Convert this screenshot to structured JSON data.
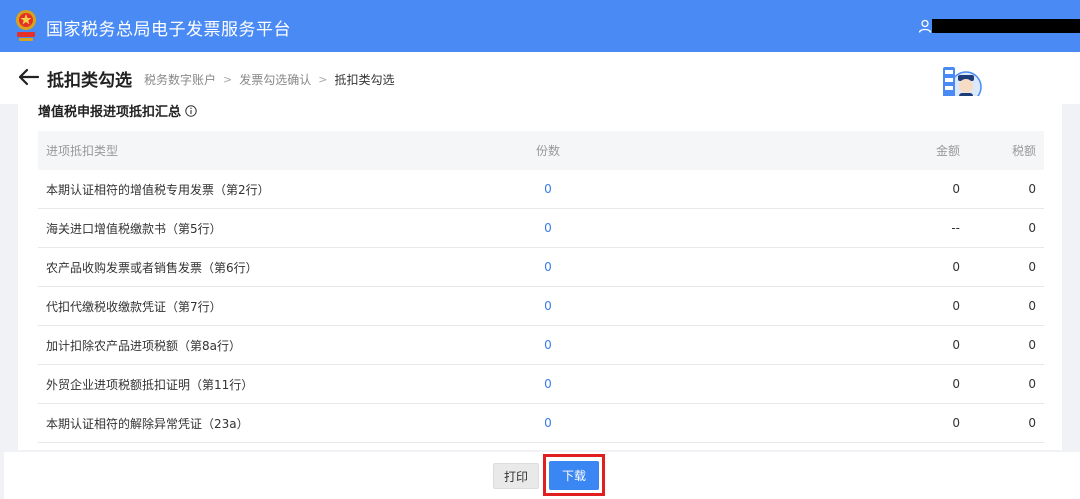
{
  "header": {
    "platform_title": "国家税务总局电子发票服务平台",
    "accent_color": "#4a8af4"
  },
  "subheader": {
    "page_title": "抵扣类勾选",
    "breadcrumb": [
      "税务数字账户",
      "发票勾选确认",
      "抵扣类勾选"
    ]
  },
  "section": {
    "title": "增值税申报进项抵扣汇总"
  },
  "table": {
    "columns": [
      "进项抵扣类型",
      "份数",
      "金额",
      "税额"
    ],
    "rows": [
      {
        "type": "本期认证相符的增值税专用发票（第2行）",
        "count": "0",
        "amount": "0",
        "tax": "0"
      },
      {
        "type": "海关进口增值税缴款书（第5行）",
        "count": "0",
        "amount": "--",
        "tax": "0"
      },
      {
        "type": "农产品收购发票或者销售发票（第6行）",
        "count": "0",
        "amount": "0",
        "tax": "0"
      },
      {
        "type": "代扣代缴税收缴款凭证（第7行）",
        "count": "0",
        "amount": "0",
        "tax": "0"
      },
      {
        "type": "加计扣除农产品进项税额（第8a行）",
        "count": "0",
        "amount": "0",
        "tax": "0"
      },
      {
        "type": "外贸企业进项税额抵扣证明（第11行）",
        "count": "0",
        "amount": "0",
        "tax": "0"
      },
      {
        "type": "本期认证相符的解除异常凭证（23a）",
        "count": "0",
        "amount": "0",
        "tax": "0"
      }
    ]
  },
  "footer": {
    "print_label": "打印",
    "download_label": "下载",
    "highlight_color": "#e02020"
  },
  "icons": {
    "logo": "tax-emblem-icon",
    "user": "user-icon",
    "back": "back-arrow-icon",
    "info": "info-icon",
    "mascot": "mascot-avatar-icon"
  }
}
